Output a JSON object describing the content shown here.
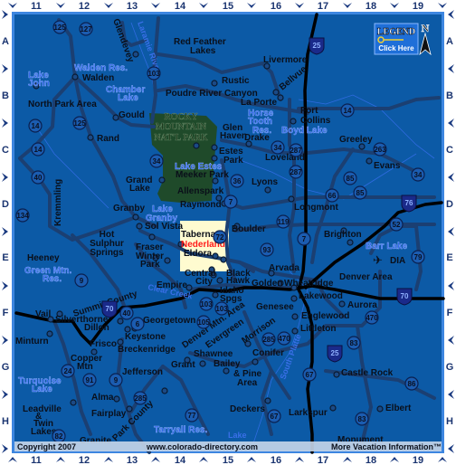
{
  "grid": {
    "columns": [
      "11",
      "12",
      "13",
      "14",
      "15",
      "16",
      "17",
      "18",
      "19"
    ],
    "rows": [
      "A",
      "B",
      "C",
      "D",
      "E",
      "F",
      "G",
      "H"
    ]
  },
  "legend": {
    "title": "LEGEND",
    "button": "Click Here"
  },
  "compass": {
    "north": "N"
  },
  "park": {
    "line1": "ROCKY",
    "line2": "MOUNTAIN",
    "line3": "NAT'L PARK"
  },
  "towns": {
    "glendevey": "Glendevey",
    "red_feather_1": "Red Feather",
    "red_feather_2": "Lakes",
    "walden": "Walden",
    "north_park": "North Park Area",
    "gould": "Gould",
    "rand": "Rand",
    "grand_lake_1": "Grand",
    "grand_lake_2": "Lake",
    "kremmling": "Kremmling",
    "granby": "Granby",
    "sol_vista": "Sol Vista",
    "meeker_park": "Meeker Park",
    "allenspark": "Allenspark",
    "raymond": "Raymond",
    "estes_1": "Estes",
    "estes_2": "Park",
    "glen_1": "Glen",
    "glen_2": "Haven",
    "livermore": "Livermore",
    "rustic": "Rustic",
    "poudre": "Poudre River Canyon",
    "bellvue": "Bellvue",
    "la_porte": "La Porte",
    "fort_1": "Fort",
    "fort_2": "Collins",
    "drake": "Drake",
    "greeley": "Greeley",
    "loveland": "Loveland",
    "evans": "Evans",
    "lyons": "Lyons",
    "longmont": "Longmont",
    "boulder": "Boulder",
    "brighton": "Brighton",
    "tabernash": "Tabernash",
    "hot_1": "Hot",
    "hot_2": "Sulphur",
    "hot_3": "Springs",
    "heeney": "Heeney",
    "fraser": "Fraser",
    "winter_1": "Winter",
    "winter_2": "Park",
    "nederland": "Nederland",
    "eldora": "Eldora",
    "central_1": "Central",
    "central_2": "City",
    "black_1": "Black",
    "black_2": "Hawk",
    "empire": "Empire",
    "idaho_1": "Idaho",
    "idaho_2": "Spgs",
    "vail": "Vail",
    "silverthorne": "Silverthorne",
    "dillon": "Dillon",
    "georgetown": "Georgetown",
    "keystone": "Keystone",
    "frisco": "Frisco",
    "breckenridge": "Breckenridge",
    "minturn": "Minturn",
    "copper_1": "Copper",
    "copper_2": "Mtn",
    "jefferson": "Jefferson",
    "alma": "Alma",
    "fairplay": "Fairplay",
    "leadville_1": "Leadville",
    "leadville_2": "&",
    "leadville_3": "Twin",
    "leadville_4": "Lakes",
    "granite": "Granite",
    "grant": "Grant",
    "shawnee": "Shawnee",
    "bailey_1": "Bailey",
    "bailey_2": "& Pine",
    "bailey_3": "Area",
    "evergreen": "Evergreen",
    "golden": "Golden",
    "arvada": "Arvada",
    "wheatridge": "Wheatridge",
    "lakewood": "Lakewood",
    "genesee": "Genesee",
    "aurora": "Aurora",
    "englewood": "Englewood",
    "littleton": "Littleton",
    "morrison": "Morrison",
    "conifer": "Conifer",
    "castle_rock": "Castle Rock",
    "deckers": "Deckers",
    "larkspur": "Larkspur",
    "elbert": "Elbert",
    "denver_area": "Denver Area",
    "dia": "DIA",
    "monument": "Monument"
  },
  "regions": {
    "summit": "Summit County",
    "park_county": "Park County",
    "denver_mtn": "Denver Mtn. Area"
  },
  "water": {
    "laramie": "Laramie River",
    "walden_res": "Walden Res.",
    "lake_john_1": "Lake",
    "lake_john_2": "John",
    "chamber_1": "Chamber",
    "chamber_2": "Lake",
    "lake_estes": "Lake Estes",
    "lake_granby_1": "Lake",
    "lake_granby_2": "Granby",
    "horsetooth_1": "Horse",
    "horsetooth_2": "Tooth",
    "horsetooth_3": "Res.",
    "boyd": "Boyd Lake",
    "green_1": "Green Mtn.",
    "green_2": "Res.",
    "clear_creek": "Clear Creek",
    "turquoise_1": "Turquoise",
    "turquoise_2": "Lake",
    "tarryall": "Tarryall Res.",
    "barr": "Barr Lake",
    "south_platte": "South Platte",
    "lake": "Lake"
  },
  "highways": {
    "us": [
      "125",
      "127",
      "103",
      "14",
      "125",
      "14",
      "40",
      "134",
      "34",
      "36",
      "7",
      "72",
      "287",
      "287",
      "34",
      "14",
      "85",
      "263",
      "34",
      "85",
      "66",
      "119",
      "52",
      "79",
      "93",
      "7",
      "9",
      "40",
      "6",
      "103",
      "103",
      "105",
      "24",
      "91",
      "9",
      "285",
      "77",
      "82",
      "470",
      "285",
      "470",
      "83",
      "67",
      "86",
      "83",
      "67"
    ],
    "interstates": [
      "25",
      "76",
      "70",
      "70",
      "25"
    ]
  },
  "footer": {
    "copyright": "Copyright 2007",
    "website": "www.colorado-directory.com",
    "more": "More Vacation Information™"
  },
  "colors": {
    "map": "#0c5aa6",
    "park": "#1f4a2a",
    "inset": "#fffbd0",
    "nederland": "#ff1a1a",
    "frame": "#0a2a80"
  }
}
